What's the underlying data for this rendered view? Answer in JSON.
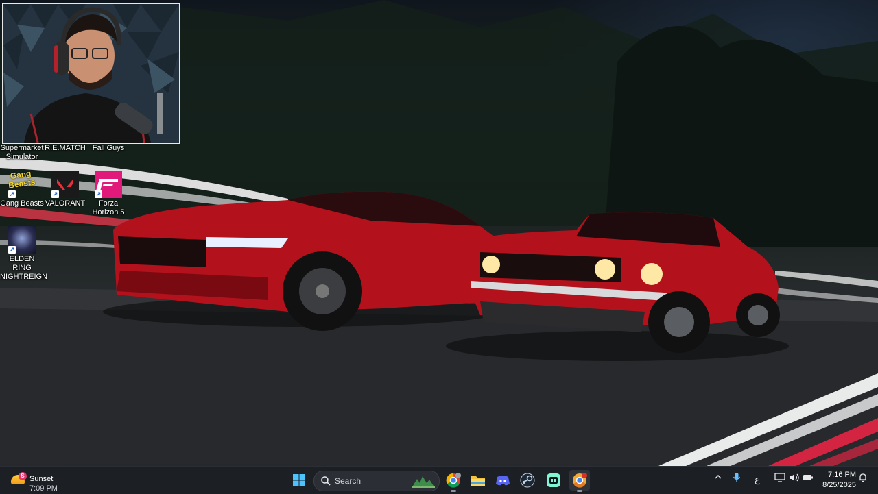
{
  "desktop": {
    "row1_labels": [
      "Supermarket\nSimulator",
      "R.E.MATCH",
      "Fall Guys"
    ],
    "icons": [
      {
        "label": "Gang Beasts",
        "art": "Gang\nBeasts"
      },
      {
        "label": "VALORANT"
      },
      {
        "label": "Forza\nHorizon 5"
      },
      {
        "label": "ELDEN RING\nNIGHTREIGN"
      }
    ]
  },
  "taskbar": {
    "weather": {
      "title": "Sunset",
      "time": "7:09 PM",
      "badge": "S"
    },
    "search_label": "Search",
    "pinned": [
      {
        "name": "chrome",
        "color": "#4285f4"
      },
      {
        "name": "file-explorer",
        "color": "#f3c13a"
      },
      {
        "name": "discord",
        "color": "#5865f2"
      },
      {
        "name": "steam",
        "color": "#1b2838"
      },
      {
        "name": "streamlabs",
        "color": "#80f5d2"
      },
      {
        "name": "chrome-canary",
        "color": "#f2a93b"
      }
    ],
    "tray": {
      "language": "ع",
      "time": "7:16 PM",
      "date": "8/25/2025"
    }
  },
  "colors": {
    "car_red": "#b3121c",
    "taskbar_bg": "#1c1f24",
    "valorant_red": "#e8303d",
    "forza_pink": "#e0197a"
  }
}
